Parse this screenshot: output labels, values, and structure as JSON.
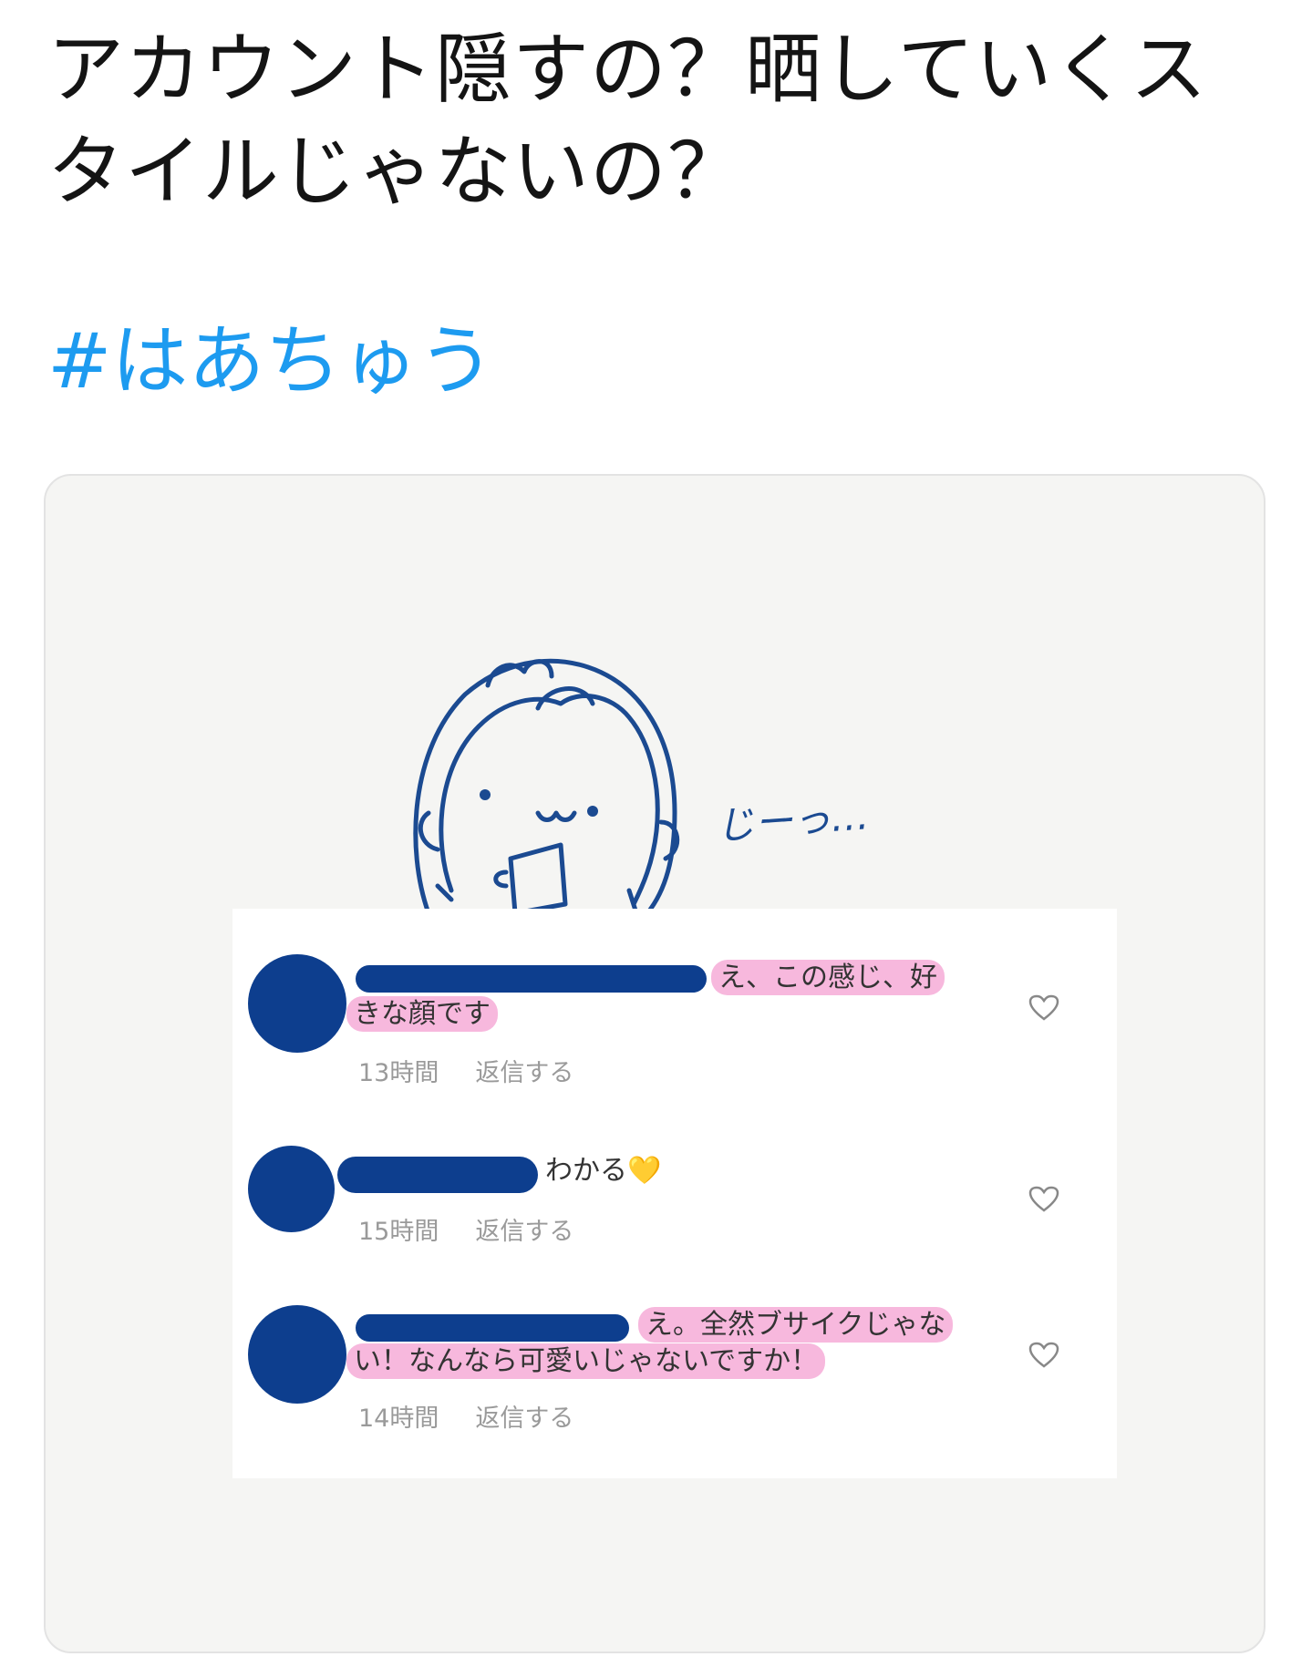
{
  "tweet": {
    "text": "アカウント隠すの？晒していくスタイルじゃないの？",
    "hashtag": "#はあちゅう"
  },
  "image": {
    "mumble": "じーっ…",
    "comments": [
      {
        "text_a": "え、この感じ、好",
        "text_b": "きな顔です",
        "time": "13時間",
        "reply": "返信する"
      },
      {
        "text_a": "わかる💛",
        "time": "15時間",
        "reply": "返信する"
      },
      {
        "text_a": "え。全然ブサイクじゃな",
        "text_b": "い！なんなら可愛いじゃないですか！",
        "time": "14時間",
        "reply": "返信する"
      }
    ]
  },
  "colors": {
    "hashtag": "#1d9bf0",
    "ink": "#0d3e8e",
    "highlight": "#f7b8dd"
  }
}
